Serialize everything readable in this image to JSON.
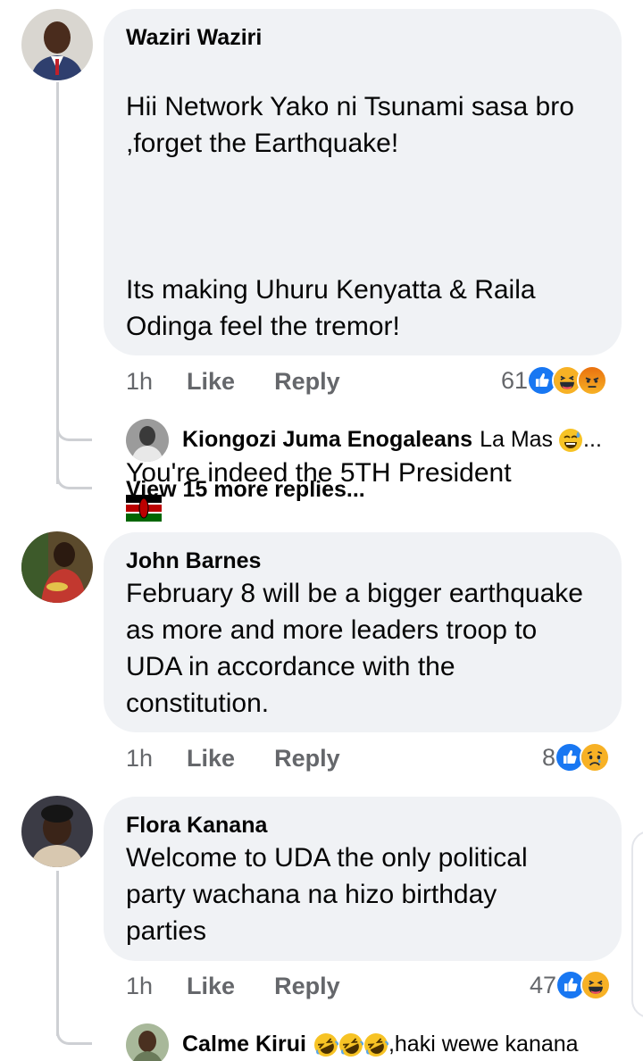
{
  "comments": [
    {
      "author": "Waziri Waziri",
      "text_lines": [
        "Hii Network Yako ni Tsunami sasa bro ,forget the Earthquake!",
        "Its making Uhuru Kenyatta & Raila Odinga feel the tremor!",
        "You're indeed the 5TH President"
      ],
      "flags": [
        "kenya-flag",
        "kenya-flag"
      ],
      "time": "1h",
      "like_label": "Like",
      "reply_label": "Reply",
      "reaction_count": "61",
      "reactions": [
        "like",
        "haha",
        "angry"
      ]
    },
    {
      "author": "John Barnes",
      "text": "February 8 will be a bigger earthquake as more and more leaders troop to UDA in accordance with the constitution.",
      "time": "1h",
      "like_label": "Like",
      "reply_label": "Reply",
      "reaction_count": "8",
      "reactions": [
        "like",
        "sad"
      ]
    },
    {
      "author": "Flora Kanana",
      "text": "Welcome to UDA the only political party wachana na hizo birthday parties",
      "time": "1h",
      "like_label": "Like",
      "reply_label": "Reply",
      "reaction_count": "47",
      "reactions": [
        "like",
        "haha"
      ]
    }
  ],
  "replies": [
    {
      "author": "Kiongozi Juma Enogaleans",
      "text": "La Mas",
      "emoji": "sweat-smile",
      "suffix": "..."
    },
    {
      "author": "Calme Kirui",
      "emoji_count": 3,
      "emoji": "rolling-laughing",
      "text": ",haki wewe kanana"
    }
  ],
  "view_more": "View 15 more replies...",
  "colors": {
    "bubble": "#f0f2f5",
    "meta": "#65676b",
    "like_blue": "#1877f2",
    "thread": "#ced0d4"
  }
}
